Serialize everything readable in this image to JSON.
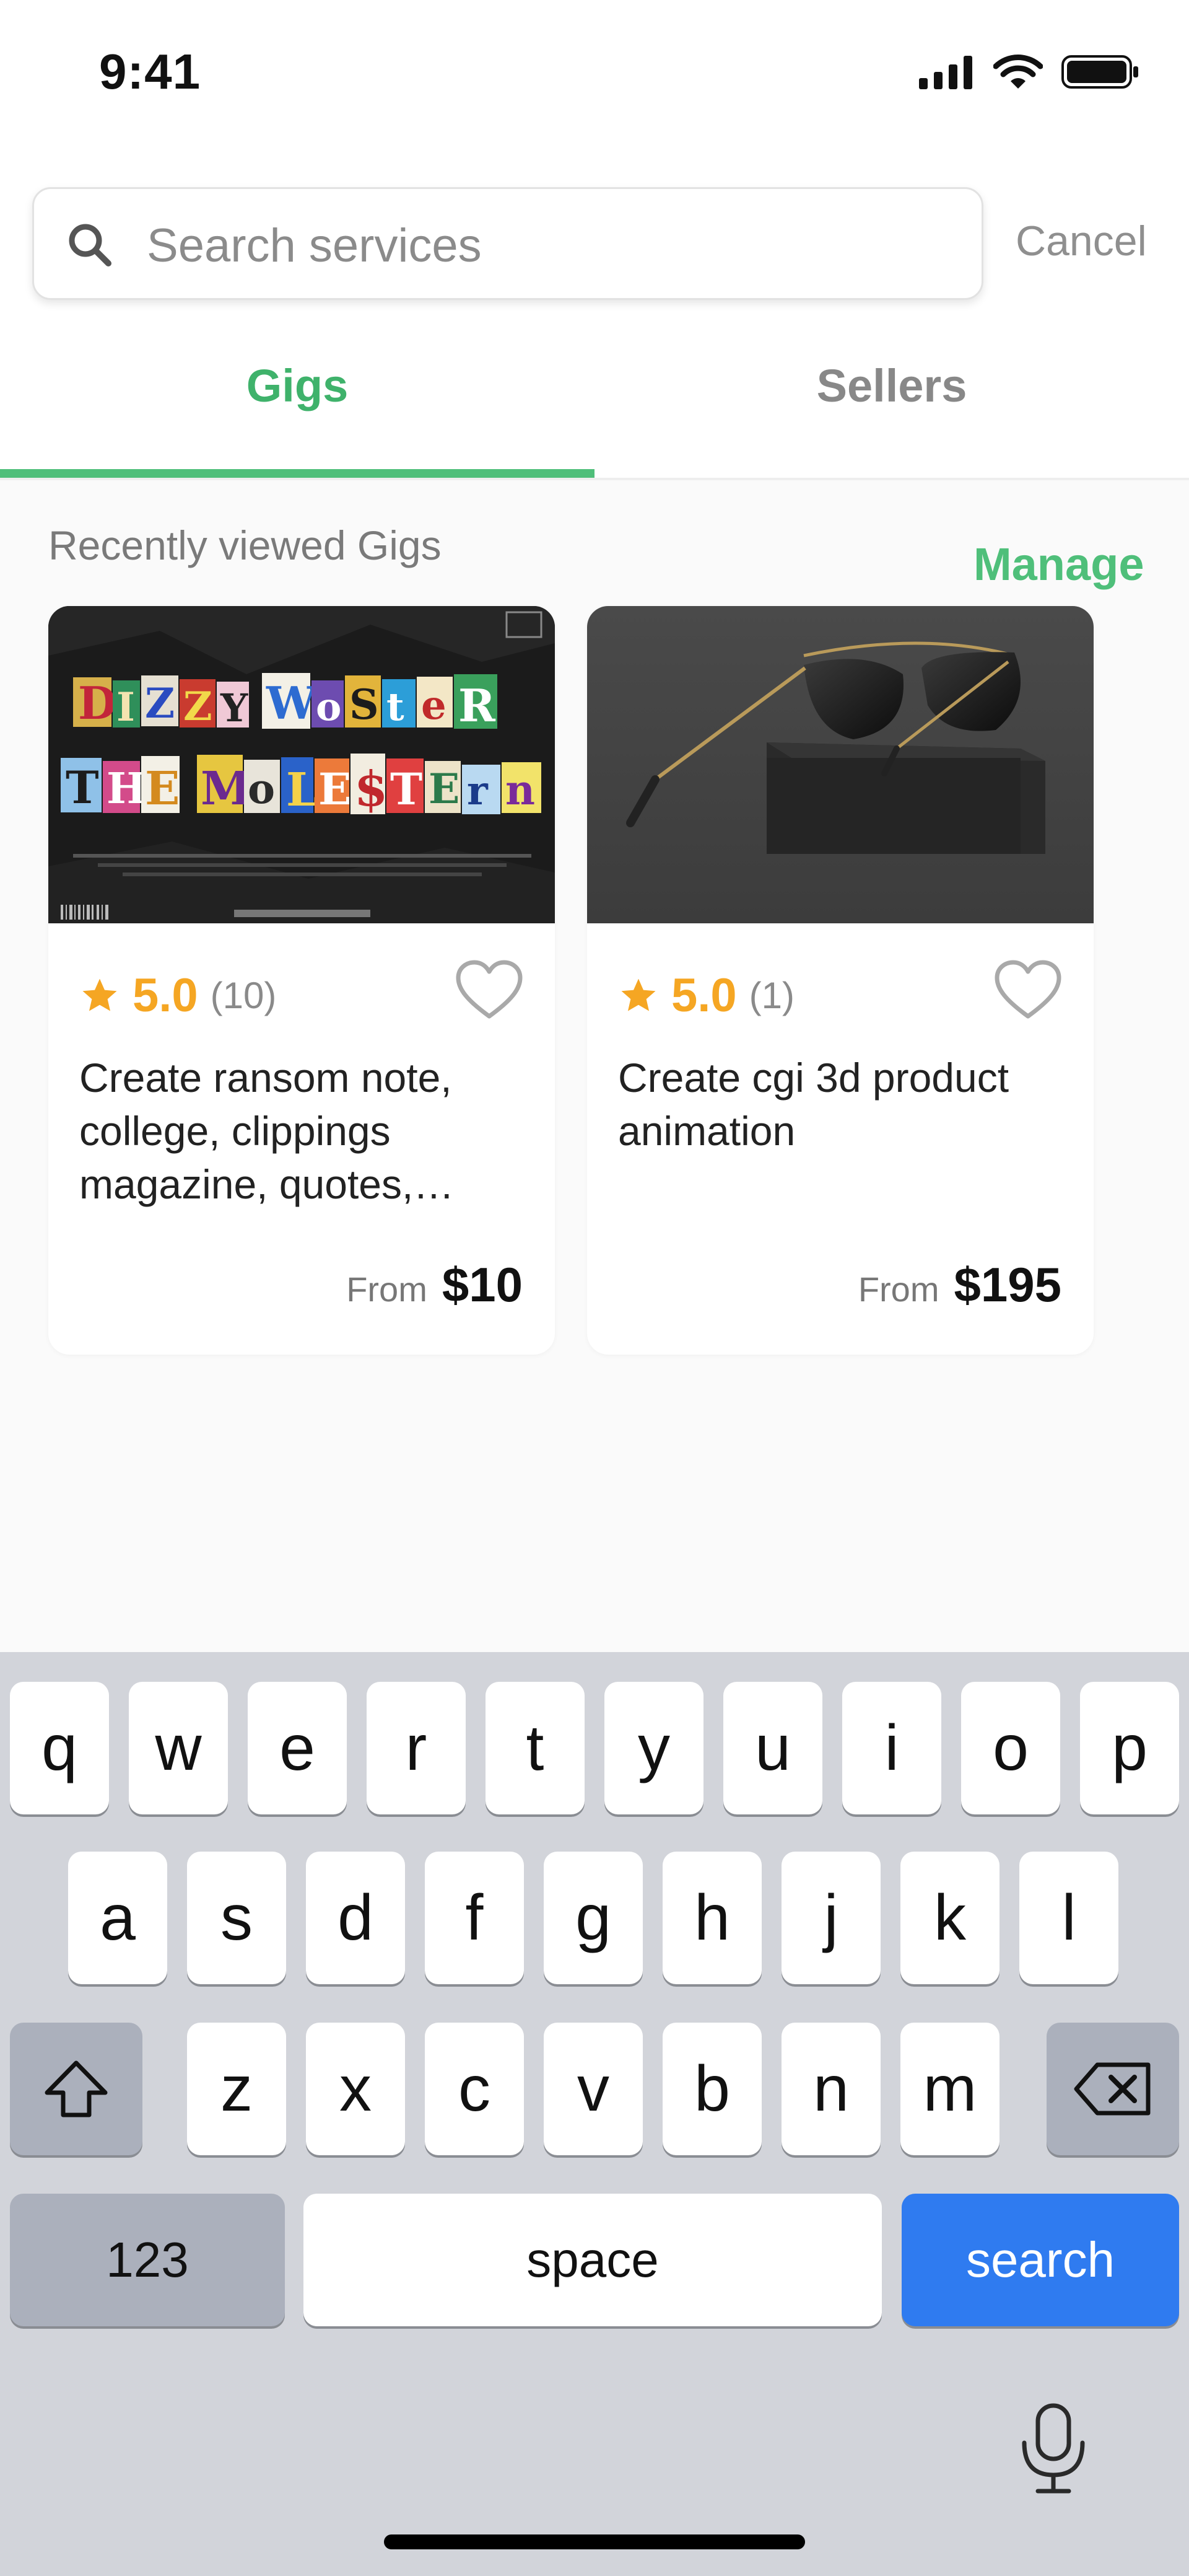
{
  "status_bar": {
    "time": "9:41"
  },
  "search": {
    "placeholder": "Search services",
    "value": "",
    "cancel_label": "Cancel"
  },
  "tabs": [
    {
      "label": "Gigs",
      "active": true
    },
    {
      "label": "Sellers",
      "active": false
    }
  ],
  "section": {
    "title": "Recently viewed Gigs",
    "manage_label": "Manage"
  },
  "gigs": [
    {
      "image": "ransom-note-collage-thumbnail",
      "rating": "5.0",
      "reviews": "(10)",
      "title": "Create ransom note, college, clippings magazine, quotes, typography",
      "price_prefix": "From",
      "price": "$10",
      "favorited": false
    },
    {
      "image": "sunglasses-on-box-thumbnail",
      "rating": "5.0",
      "reviews": "(1)",
      "title": "Create cgi 3d product animation",
      "price_prefix": "From",
      "price": "$195",
      "favorited": false
    }
  ],
  "keyboard": {
    "row1": [
      "q",
      "w",
      "e",
      "r",
      "t",
      "y",
      "u",
      "i",
      "o",
      "p"
    ],
    "row2": [
      "a",
      "s",
      "d",
      "f",
      "g",
      "h",
      "j",
      "k",
      "l"
    ],
    "row3": [
      "z",
      "x",
      "c",
      "v",
      "b",
      "n",
      "m"
    ],
    "numbers_label": "123",
    "space_label": "space",
    "search_label": "search"
  },
  "colors": {
    "accent_green": "#4fbf7a",
    "star": "#f5a623",
    "search_key": "#2f7bf0"
  }
}
